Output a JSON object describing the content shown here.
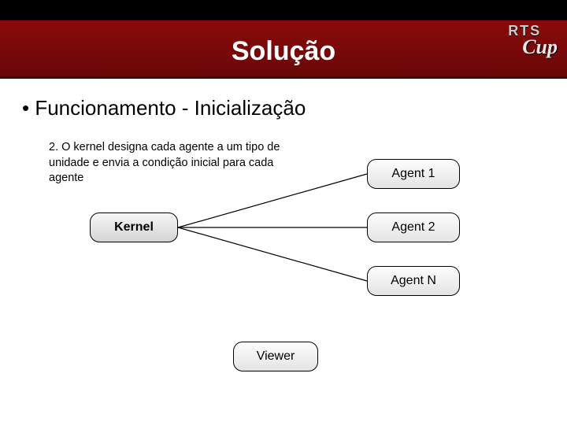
{
  "header": {
    "title": "Solução",
    "logo_top": "RTS",
    "logo_bottom": "Cup"
  },
  "bullet": "• Funcionamento - Inicialização",
  "description": "2. O kernel designa cada agente a um tipo de unidade e envia a condição inicial para cada agente",
  "nodes": {
    "kernel": "Kernel",
    "agent1": "Agent 1",
    "agent2": "Agent 2",
    "agentn": "Agent N",
    "viewer": "Viewer"
  }
}
